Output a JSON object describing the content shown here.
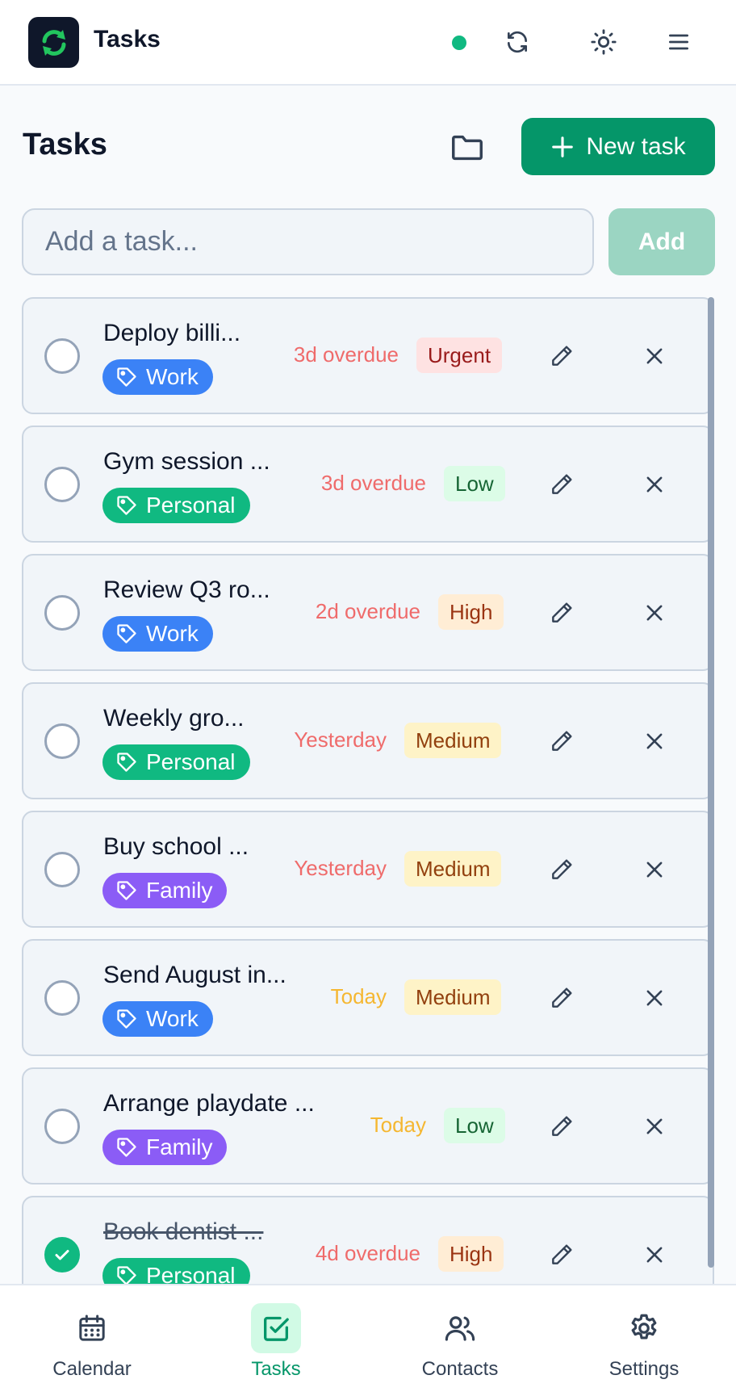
{
  "app": {
    "title": "Tasks",
    "status": "online"
  },
  "header_icons": [
    "sync-icon",
    "brightness-icon",
    "menu-icon"
  ],
  "page": {
    "title": "Tasks",
    "new_task_label": "New task"
  },
  "add_task": {
    "placeholder": "Add a task...",
    "button_label": "Add"
  },
  "tasks": [
    {
      "title": "Deploy billi...",
      "tag": "Work",
      "due": "3d overdue",
      "priority": "Urgent",
      "done": false
    },
    {
      "title": "Gym session ...",
      "tag": "Personal",
      "due": "3d overdue",
      "priority": "Low",
      "done": false
    },
    {
      "title": "Review Q3 ro...",
      "tag": "Work",
      "due": "2d overdue",
      "priority": "High",
      "done": false
    },
    {
      "title": "Weekly gro...",
      "tag": "Personal",
      "due": "Yesterday",
      "priority": "Medium",
      "done": false
    },
    {
      "title": "Buy school ...",
      "tag": "Family",
      "due": "Yesterday",
      "priority": "Medium",
      "done": false
    },
    {
      "title": "Send August in...",
      "tag": "Work",
      "due": "Today",
      "priority": "Medium",
      "done": false
    },
    {
      "title": "Arrange playdate ...",
      "tag": "Family",
      "due": "Today",
      "priority": "Low",
      "done": false
    },
    {
      "title": "Book dentist ...",
      "tag": "Personal",
      "due": "4d overdue",
      "priority": "High",
      "done": true
    }
  ],
  "tag_colors": {
    "Work": "#3b82f6",
    "Personal": "#10b981",
    "Family": "#8b5cf6"
  },
  "priority_colors": {
    "Urgent": {
      "bg": "#fee2e2",
      "fg": "#991b1b"
    },
    "High": {
      "bg": "#ffedd5",
      "fg": "#9a3412"
    },
    "Medium": {
      "bg": "#fef3c7",
      "fg": "#92400e"
    },
    "Low": {
      "bg": "#dcfce7",
      "fg": "#166534"
    }
  },
  "due_colors": {
    "overdue": "#ef6b6b",
    "today": "#f5b731"
  },
  "nav": [
    {
      "label": "Calendar",
      "icon": "calendar-icon",
      "active": false
    },
    {
      "label": "Tasks",
      "icon": "check-square-icon",
      "active": true
    },
    {
      "label": "Contacts",
      "icon": "users-icon",
      "active": false
    },
    {
      "label": "Settings",
      "icon": "gear-icon",
      "active": false
    }
  ]
}
